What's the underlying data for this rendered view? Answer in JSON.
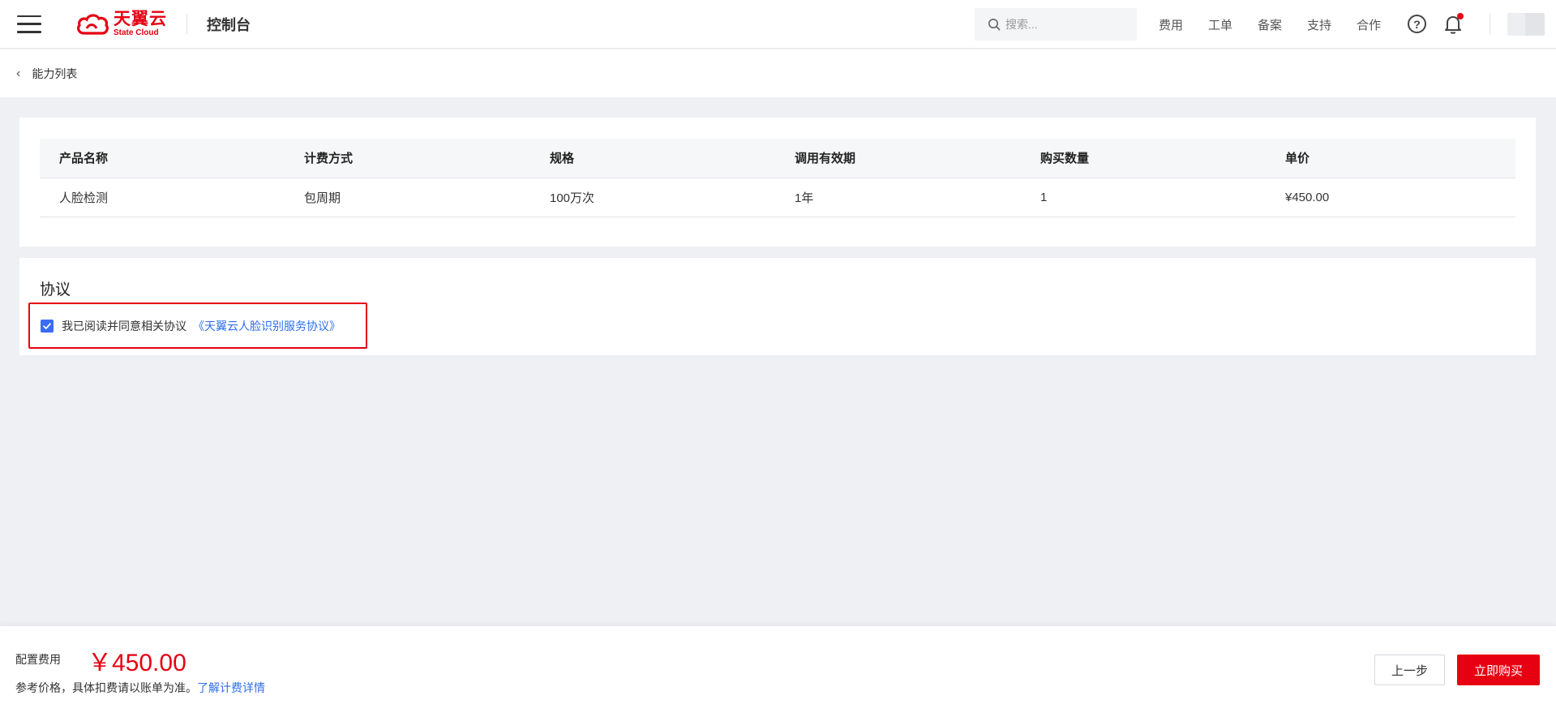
{
  "header": {
    "brand_cn": "天翼云",
    "brand_en": "State Cloud",
    "console_title": "控制台",
    "search_placeholder": "搜索...",
    "nav_links": [
      "费用",
      "工单",
      "备案",
      "支持",
      "合作"
    ],
    "accent_color": "#e60012"
  },
  "breadcrumb": {
    "back_label": "能力列表"
  },
  "product_table": {
    "columns": [
      "产品名称",
      "计费方式",
      "规格",
      "调用有效期",
      "购买数量",
      "单价"
    ],
    "rows": [
      [
        "人脸检测",
        "包周期",
        "100万次",
        "1年",
        "1",
        "¥450.00"
      ]
    ]
  },
  "agreement": {
    "title": "协议",
    "checked": true,
    "text": "我已阅读并同意相关协议",
    "link": "《天翼云人脸识别服务协议》"
  },
  "footer": {
    "fee_label": "配置费用",
    "fee_amount": "￥450.00",
    "note": "参考价格，具体扣费请以账单为准。",
    "note_link": "了解计费详情",
    "prev_button": "上一步",
    "buy_button": "立即购买"
  }
}
